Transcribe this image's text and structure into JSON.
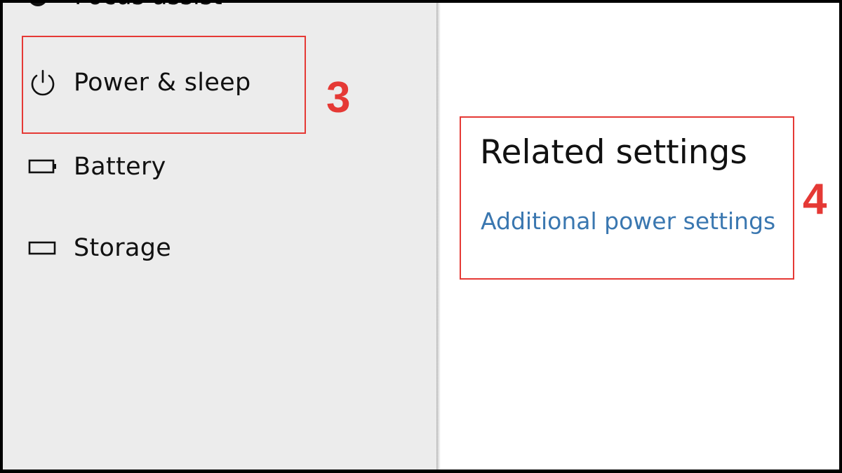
{
  "sidebar": {
    "partial_item": {
      "label": "Focus assist",
      "icon": "focus-assist-icon"
    },
    "items": [
      {
        "label": "Power & sleep",
        "icon": "power-icon"
      },
      {
        "label": "Battery",
        "icon": "battery-icon"
      },
      {
        "label": "Storage",
        "icon": "storage-icon"
      }
    ]
  },
  "main": {
    "related_settings_title": "Related settings",
    "additional_power_link": "Additional power settings"
  },
  "annotations": [
    {
      "number": "3"
    },
    {
      "number": "4"
    }
  ],
  "colors": {
    "annotation": "#e53935",
    "link": "#3a77b0",
    "sidebar_bg": "#ececec"
  }
}
